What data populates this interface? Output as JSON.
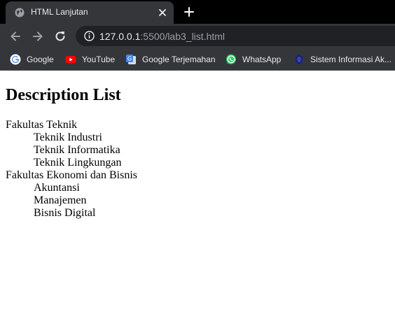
{
  "browser": {
    "tab": {
      "title": "HTML Lanjutan"
    },
    "address_bar": {
      "host": "127.0.0.1",
      "rest": ":5500/lab3_list.html"
    },
    "bookmarks": [
      {
        "label": "Google",
        "icon": "google-icon"
      },
      {
        "label": "YouTube",
        "icon": "youtube-icon"
      },
      {
        "label": "Google Terjemahan",
        "icon": "translate-icon"
      },
      {
        "label": "WhatsApp",
        "icon": "whatsapp-icon"
      },
      {
        "label": "Sistem Informasi Ak...",
        "icon": "university-icon"
      }
    ],
    "colors": {
      "titlebar": "#000000",
      "toolbar": "#35363a",
      "omnibox": "#202124",
      "text": "#e8eaed"
    }
  },
  "page": {
    "heading": "Description List",
    "list": [
      {
        "term": "Fakultas Teknik",
        "descriptions": [
          "Teknik Industri",
          "Teknik Informatika",
          "Teknik Lingkungan"
        ]
      },
      {
        "term": "Fakultas Ekonomi dan Bisnis",
        "descriptions": [
          "Akuntansi",
          "Manajemen",
          "Bisnis Digital"
        ]
      }
    ]
  }
}
